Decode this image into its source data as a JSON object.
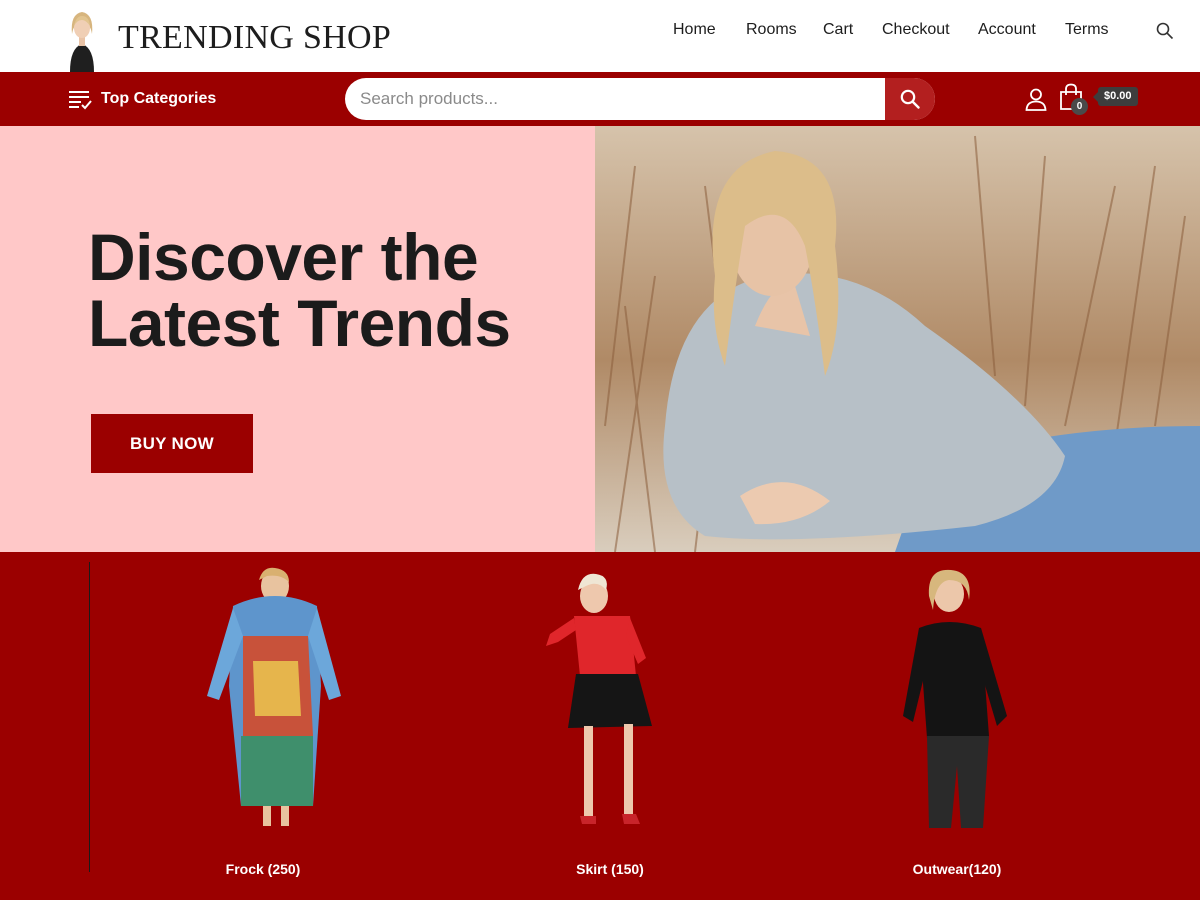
{
  "brand": {
    "name": "TRENDING SHOP",
    "logo_icon": "model-portrait-logo"
  },
  "nav": {
    "items": [
      {
        "label": "Home"
      },
      {
        "label": "Rooms"
      },
      {
        "label": "Cart"
      },
      {
        "label": "Checkout"
      },
      {
        "label": "Account"
      },
      {
        "label": "Terms"
      }
    ],
    "search_icon": "search-icon"
  },
  "toolbar": {
    "categories_label": "Top Categories",
    "categories_icon": "list-check-icon",
    "search_placeholder": "Search products...",
    "search_button_icon": "search-icon",
    "user_icon": "user-icon",
    "cart_icon": "shopping-bag-icon",
    "cart_count": "0",
    "cart_total": "$0.00"
  },
  "hero": {
    "title_line1": "Discover the",
    "title_line2": "Latest Trends",
    "button_label": "BUY NOW",
    "image": "woman-in-grey-sweater-lying-in-dry-grass"
  },
  "categories": [
    {
      "label": "Frock (250)",
      "image": "woman-in-printed-kaftan-dress"
    },
    {
      "label": "Skirt (150)",
      "image": "woman-in-red-top-black-skirt"
    },
    {
      "label": "Outwear(120)",
      "image": "woman-in-black-turtleneck"
    }
  ],
  "colors": {
    "brand_red": "#9b0000",
    "hero_pink": "#ffc8c8",
    "search_button": "#b31f1f",
    "cart_badge": "#3d3d3d"
  }
}
